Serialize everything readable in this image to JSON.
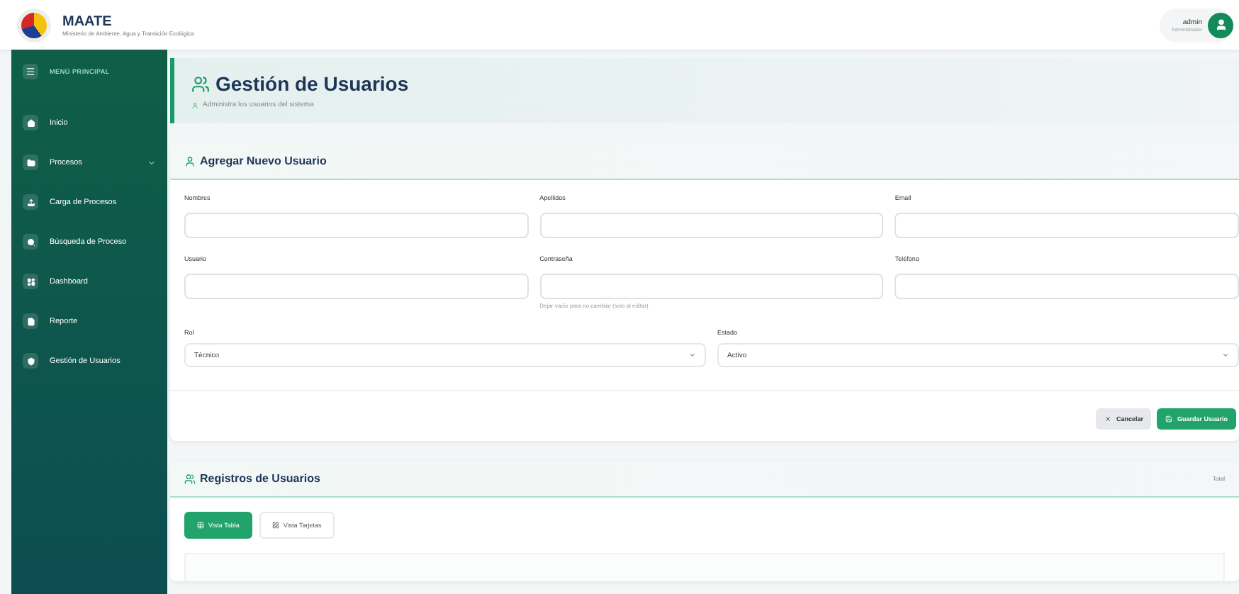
{
  "brand": {
    "name": "MAATE",
    "subtitle": "Ministerio de Ambiente, Agua y Transición Ecológica"
  },
  "user": {
    "name": "admin",
    "role": "Administrador"
  },
  "sidebar": {
    "title": "MENÚ PRINCIPAL",
    "items": [
      {
        "label": "Inicio",
        "expandable": false
      },
      {
        "label": "Procesos",
        "expandable": true
      },
      {
        "label": "Carga de Procesos",
        "expandable": false
      },
      {
        "label": "Búsqueda de Proceso",
        "expandable": false
      },
      {
        "label": "Dashboard",
        "expandable": false
      },
      {
        "label": "Reporte",
        "expandable": false
      },
      {
        "label": "Gestión de Usuarios",
        "expandable": false
      }
    ]
  },
  "page": {
    "title": "Gestión de Usuarios",
    "subtitle": "Administra los usuarios del sistema"
  },
  "form": {
    "title": "Agregar Nuevo Usuario",
    "fields": [
      {
        "kind": "input",
        "label": "Nombres"
      },
      {
        "kind": "input",
        "label": "Apellidos"
      },
      {
        "kind": "input",
        "label": "Email"
      },
      {
        "kind": "input",
        "label": "Usuario"
      },
      {
        "kind": "input",
        "label": "Contraseña",
        "help": "Dejar vacío para no cambiar (solo al editar)"
      },
      {
        "kind": "input",
        "label": "Teléfono"
      }
    ],
    "selects": [
      {
        "label": "Rol",
        "value": "Técnico"
      },
      {
        "label": "Estado",
        "value": "Activo"
      }
    ],
    "buttons": [
      {
        "label": "Cancelar",
        "kind": "secondary"
      },
      {
        "label": "Guardar Usuario",
        "kind": "primary"
      }
    ]
  },
  "records": {
    "title": "Registros de Usuarios",
    "total": "Total",
    "views": [
      {
        "label": "Vista Tabla",
        "selected": true
      },
      {
        "label": "Vista Tarjetas",
        "selected": false
      }
    ]
  }
}
